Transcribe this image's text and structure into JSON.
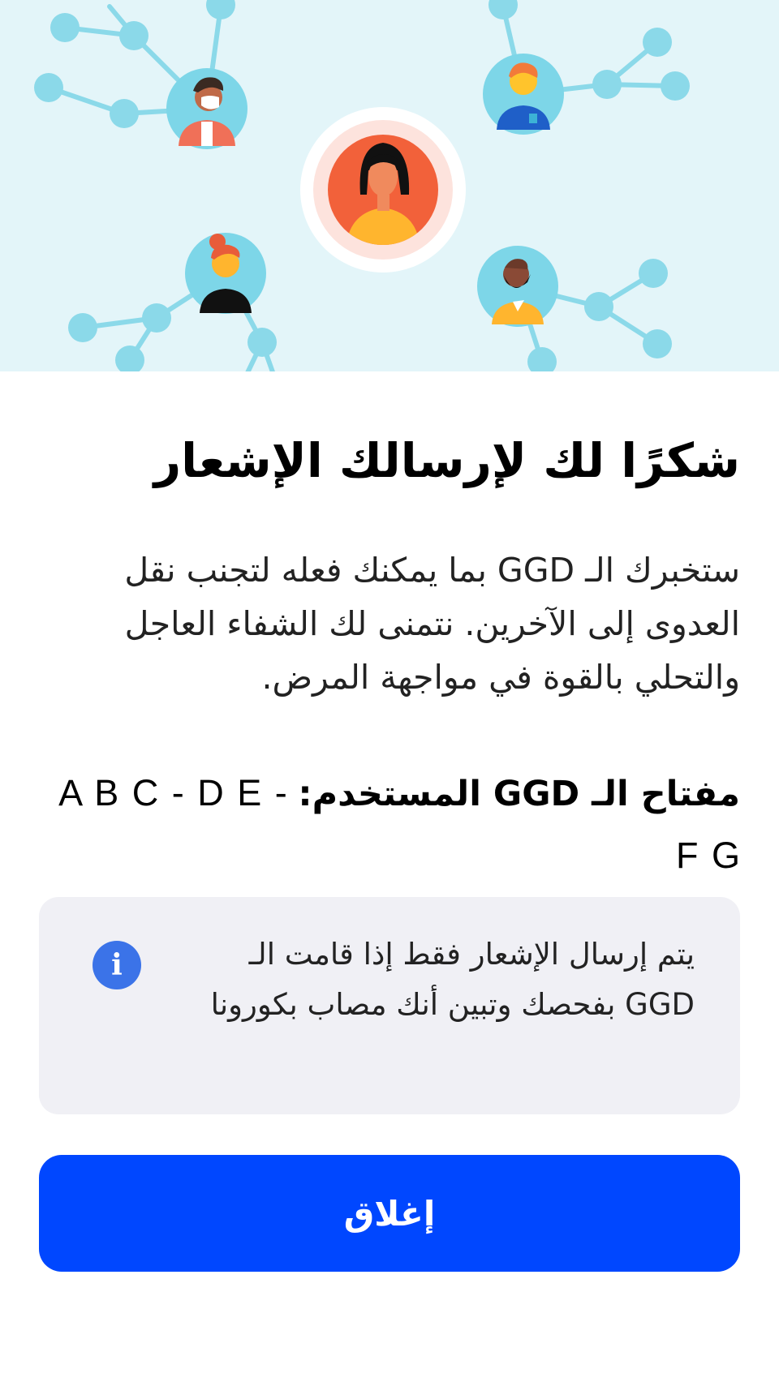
{
  "header": {
    "illustration_icon": "contact-network-illustration"
  },
  "content": {
    "title": "شكرًا لك لإرسالك الإشعار",
    "body": "ستخبرك الـ GGD بما يمكنك فعله لتجنب نقل العدوى إلى الآخرين. نتمنى لك الشفاء العاجل والتحلي بالقوة في مواجهة المرض.",
    "key_label": "مفتاح الـ GGD المستخدم:",
    "key_value": "A B C - D E - F G"
  },
  "info": {
    "icon": "info-icon",
    "icon_glyph": "i",
    "text": "يتم إرسال الإشعار فقط إذا قامت الـ GGD بفحصك وتبين أنك مصاب بكورونا"
  },
  "actions": {
    "close_label": "إغلاق"
  },
  "colors": {
    "accent": "#0047ff",
    "info_icon": "#3b73e8",
    "header_bg": "#e3f5f9",
    "info_bg": "#f0f0f5"
  }
}
